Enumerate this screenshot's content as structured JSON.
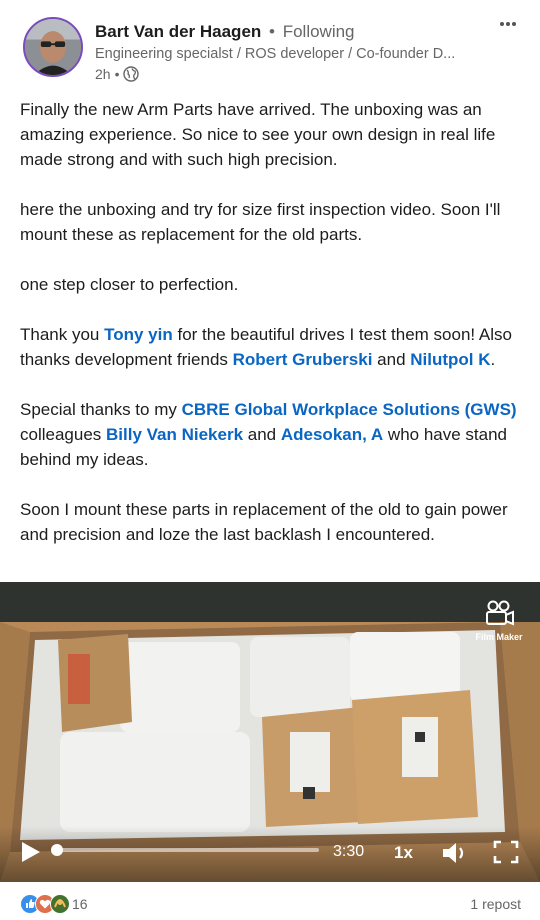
{
  "author": {
    "name": "Bart Van der Haagen",
    "separator": "•",
    "follow_status": "Following",
    "headline": "Engineering specialst / ROS developer / Co-founder D...",
    "time_ago": "2h",
    "time_separator": "•",
    "visibility_icon": "globe-icon"
  },
  "post": {
    "p1": "Finally the new Arm Parts have arrived. The unboxing was an amazing experience. So nice to see your own design in real life made strong and with such high precision.",
    "p2": "here the unboxing and try for size first inspection video. Soon I'll mount these as replacement for the old parts.",
    "p3": "one step closer to perfection.",
    "p4_a": "Thank you ",
    "mention_1": "Tony yin",
    "p4_b": " for the beautiful drives I test them soon! Also thanks development friends ",
    "mention_2": "Robert Gruberski",
    "p4_c": " and ",
    "mention_3": "Nilutpol K",
    "p4_d": ".",
    "p5_a": "Special thanks to my ",
    "mention_4": "CBRE Global Workplace Solutions (GWS)",
    "p5_b": " colleagues ",
    "mention_5": "Billy Van Niekerk",
    "p5_c": " and ",
    "mention_6": "Adesokan, A",
    "p5_d": " who have stand behind my ideas.",
    "p6": "Soon I mount these parts in replacement of the old to gain power and precision and loze the last backlash I encountered."
  },
  "video": {
    "watermark_label": "Film Maker",
    "duration": "3:30",
    "speed": "1x",
    "progress": 0.0
  },
  "footer": {
    "reaction_icons": [
      "like-icon",
      "love-icon",
      "support-icon"
    ],
    "reaction_count": "16",
    "reposts": "1 repost"
  },
  "colors": {
    "link": "#0a66c2",
    "secondary_text": "#666666",
    "avatar_ring": "#7a4bbd"
  }
}
